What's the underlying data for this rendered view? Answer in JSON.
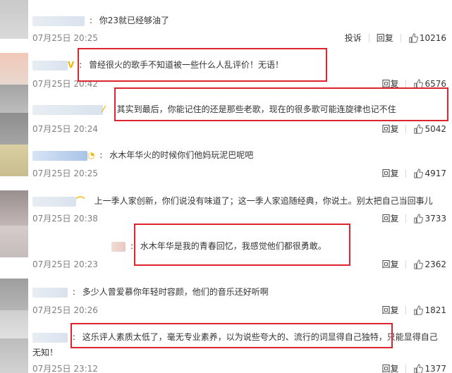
{
  "comments": [
    {
      "text": "你23就已经够油了",
      "time": "07月25日 20:25",
      "report": "投诉",
      "reply": "回复",
      "likes": "10216"
    },
    {
      "text": "曾经很火的歌手不知道被一些什么人乱评价！无语！",
      "time": "07月25日 20:42",
      "reply": "回复",
      "likes": "6576"
    },
    {
      "text": "其实到最后，你能记住的还是那些老歌，现在的很多歌可能连旋律也记不住",
      "time": "07月25日 20:24",
      "reply": "回复",
      "likes": "5042"
    },
    {
      "text": "水木年华火的时候你们他妈玩泥巴呢吧",
      "time": "07月25日 20:25",
      "reply": "回复",
      "likes": "4917"
    },
    {
      "text": "上一季人家创新，你们说没有味道了；这一季人家追随经典，你说土。别太把自己当回事儿",
      "time": "07月25日 20:38",
      "reply": "回复",
      "likes": "3733"
    },
    {
      "text": "水木年华是我的青春回忆，我感觉他们都很勇敢。",
      "time": "07月25日 20:23",
      "reply": "回复",
      "likes": "2362"
    },
    {
      "text": "多少人曾爱慕你年轻时容颜，他们的音乐还好听啊",
      "time": "07月25日 20:26",
      "reply": "回复",
      "likes": "1821"
    },
    {
      "text": "这乐评人素质太低了，毫无专业素养，以为说些夸大的、流行的词显得自己独特，只能显得自己",
      "text_cont": "无知！",
      "time": "07月25日 23:12",
      "reply": "回复",
      "likes": "1377"
    }
  ],
  "colors": {
    "highlight": "#e0242f",
    "time": "#808080",
    "text": "#333333"
  },
  "icons": {
    "like": "thumbs-up-icon"
  }
}
